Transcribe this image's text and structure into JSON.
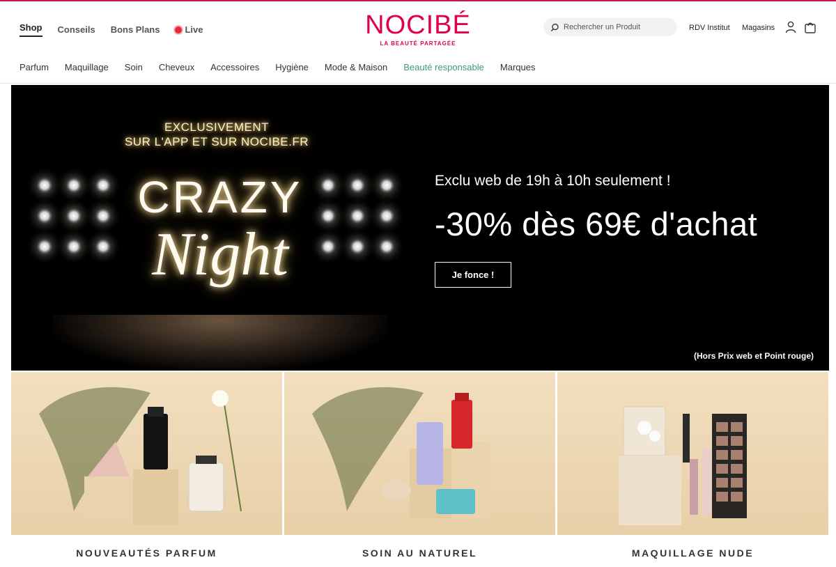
{
  "brand": {
    "name": "NOCIBÉ",
    "tagline": "LA BEAUTÉ PARTAGÉE",
    "color": "#e0004d"
  },
  "top_nav": [
    {
      "label": "Shop",
      "active": true
    },
    {
      "label": "Conseils"
    },
    {
      "label": "Bons Plans"
    },
    {
      "label": "Live",
      "icon": "live-dot-icon"
    }
  ],
  "search": {
    "placeholder": "Rechercher un Produit",
    "icon": "search-icon"
  },
  "utility": {
    "rdv": "RDV Institut",
    "stores": "Magasins",
    "account_icon": "user-icon",
    "cart_icon": "bag-icon"
  },
  "categories": [
    "Parfum",
    "Maquillage",
    "Soin",
    "Cheveux",
    "Accessoires",
    "Hygiène",
    "Mode & Maison",
    "Beauté responsable",
    "Marques"
  ],
  "hero": {
    "exclusive_line1": "EXCLUSIVEMENT",
    "exclusive_line2": "SUR L'APP ET SUR NOCIBE.FR",
    "title_crazy": "CRAZY",
    "title_night": "Night",
    "subtitle": "Exclu web de 19h à 10h seulement !",
    "promo": "-30% dès 69€ d'achat",
    "cta": "Je fonce !",
    "note": "(Hors Prix web et Point rouge)"
  },
  "tiles": [
    {
      "label": "NOUVEAUTÉS PARFUM"
    },
    {
      "label": "SOIN AU NATUREL"
    },
    {
      "label": "MAQUILLAGE NUDE"
    }
  ]
}
